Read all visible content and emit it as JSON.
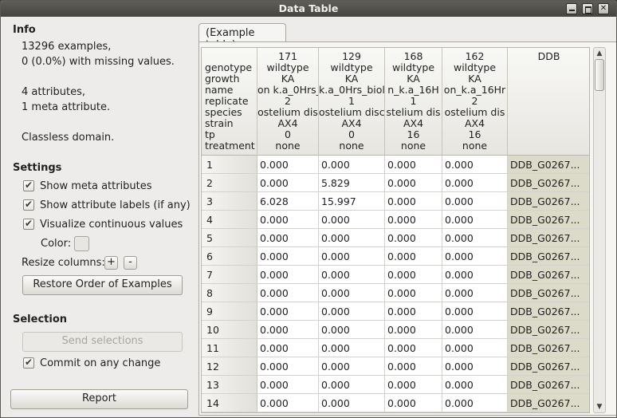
{
  "window": {
    "title": "Data Table"
  },
  "info": {
    "heading": "Info",
    "lines": [
      "13296 examples,",
      "0 (0.0%) with missing values.",
      "4 attributes,",
      "1 meta attribute.",
      "Classless domain."
    ]
  },
  "settings": {
    "heading": "Settings",
    "show_meta": "Show meta attributes",
    "show_labels": "Show attribute labels (if any)",
    "visualize": "Visualize continuous values",
    "color_label": "Color:",
    "resize_label": "Resize columns:",
    "plus": "+",
    "minus": "-",
    "restore_button": "Restore Order of Examples"
  },
  "selection": {
    "heading": "Selection",
    "send_button": "Send selections",
    "commit": "Commit on any change"
  },
  "report_button": "Report",
  "tab_label": "(Example table)",
  "table": {
    "header_labels": [
      "genotype",
      "growth",
      "name",
      "replicate",
      "species",
      "strain",
      "tp",
      "treatment"
    ],
    "columns": [
      {
        "id": "171",
        "labels": [
          "wildtype",
          "KA",
          "on k.a_0Hrs_",
          "2",
          "ostelium dis",
          "AX4",
          "0",
          "none"
        ]
      },
      {
        "id": "129",
        "labels": [
          "wildtype",
          "KA",
          "k.a_0Hrs_biol",
          "1",
          "ostelium disc",
          "AX4",
          "0",
          "none"
        ]
      },
      {
        "id": "168",
        "labels": [
          "wildtype",
          "KA",
          "n_k.a_16H",
          "1",
          "stelium dis",
          "AX4",
          "16",
          "none"
        ]
      },
      {
        "id": "162",
        "labels": [
          "wildtype",
          "KA",
          "on_k.a_16Hr",
          "2",
          "ostelium dis",
          "AX4",
          "16",
          "none"
        ]
      },
      {
        "id": "DDB",
        "labels": [
          "",
          "",
          "",
          "",
          "",
          "",
          "",
          ""
        ]
      }
    ],
    "rows": [
      {
        "n": "1",
        "v": [
          "0.000",
          "0.000",
          "0.000",
          "0.000",
          "DDB_G0267..."
        ]
      },
      {
        "n": "2",
        "v": [
          "0.000",
          "5.829",
          "0.000",
          "0.000",
          "DDB_G0267..."
        ]
      },
      {
        "n": "3",
        "v": [
          "6.028",
          "15.997",
          "0.000",
          "0.000",
          "DDB_G0267..."
        ]
      },
      {
        "n": "4",
        "v": [
          "0.000",
          "0.000",
          "0.000",
          "0.000",
          "DDB_G0267..."
        ]
      },
      {
        "n": "5",
        "v": [
          "0.000",
          "0.000",
          "0.000",
          "0.000",
          "DDB_G0267..."
        ]
      },
      {
        "n": "6",
        "v": [
          "0.000",
          "0.000",
          "0.000",
          "0.000",
          "DDB_G0267..."
        ]
      },
      {
        "n": "7",
        "v": [
          "0.000",
          "0.000",
          "0.000",
          "0.000",
          "DDB_G0267..."
        ]
      },
      {
        "n": "8",
        "v": [
          "0.000",
          "0.000",
          "0.000",
          "0.000",
          "DDB_G0267..."
        ]
      },
      {
        "n": "9",
        "v": [
          "0.000",
          "0.000",
          "0.000",
          "0.000",
          "DDB_G0267..."
        ]
      },
      {
        "n": "10",
        "v": [
          "0.000",
          "0.000",
          "0.000",
          "0.000",
          "DDB_G0267..."
        ]
      },
      {
        "n": "11",
        "v": [
          "0.000",
          "0.000",
          "0.000",
          "0.000",
          "DDB_G0267..."
        ]
      },
      {
        "n": "12",
        "v": [
          "0.000",
          "0.000",
          "0.000",
          "0.000",
          "DDB_G0267..."
        ]
      },
      {
        "n": "13",
        "v": [
          "0.000",
          "0.000",
          "0.000",
          "0.000",
          "DDB_G0267..."
        ]
      },
      {
        "n": "14",
        "v": [
          "0.000",
          "0.000",
          "0.000",
          "0.000",
          "DDB_G0267..."
        ]
      }
    ]
  }
}
